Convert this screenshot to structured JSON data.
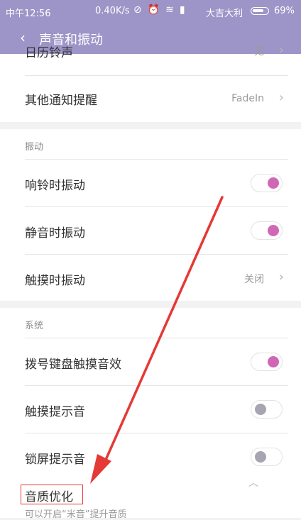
{
  "status": {
    "time": "中午12:56",
    "speed": "0.40K/s",
    "carrier": "大吉大利",
    "battery": "69%",
    "battery_level": 0.69
  },
  "appbar": {
    "title": "声音和振动"
  },
  "rows": {
    "alarm": {
      "label": "日历铃声",
      "value": "无"
    },
    "notify": {
      "label": "其他通知提醒",
      "value": "FadeIn"
    }
  },
  "vibrate": {
    "header": "振动",
    "ring": {
      "label": "响铃时振动",
      "on": true
    },
    "silent": {
      "label": "静音时振动",
      "on": true
    },
    "touch": {
      "label": "触摸时振动",
      "value": "关闭"
    }
  },
  "system": {
    "header": "系统",
    "dial": {
      "label": "拨号键盘触摸音效",
      "on": true
    },
    "touch_tone": {
      "label": "触摸提示音",
      "on": false
    },
    "lock": {
      "label": "锁屏提示音",
      "on": false
    },
    "quality": {
      "label": "音质优化",
      "hint": "可以开启“米音”提升音质"
    }
  },
  "colors": {
    "accent": "#9d95c7",
    "toggle_on": "#d067b5",
    "annotation": "#e53935"
  }
}
